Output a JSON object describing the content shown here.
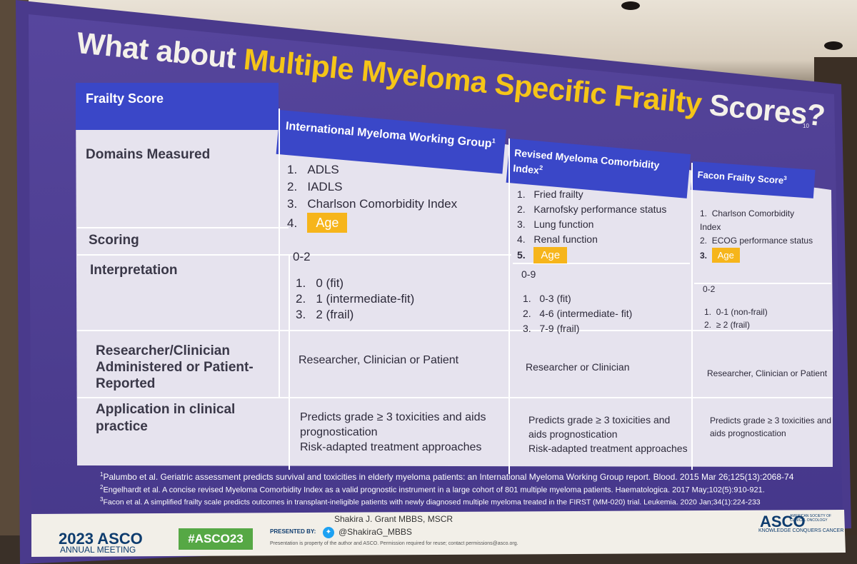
{
  "slide": {
    "title_prefix": "What about ",
    "title_highlight": "Multiple Myeloma Specific Frailty",
    "title_suffix": " Scores?",
    "slide_number": "10"
  },
  "table": {
    "corner_header": "Frailty Score",
    "columns": [
      {
        "name": "International Myeloma Working Group",
        "ref": "1"
      },
      {
        "name": "Revised Myeloma Comorbidity Index",
        "ref": "2"
      },
      {
        "name": "Facon Frailty Score",
        "ref": "3"
      }
    ],
    "row_labels": {
      "domains": "Domains Measured",
      "scoring": "Scoring",
      "interpretation": "Interpretation",
      "administered": "Researcher/Clinician Administered or Patient-Reported",
      "application": "Application in clinical practice"
    },
    "imwg": {
      "domains": [
        "ADLS",
        "IADLS",
        "Charlson Comorbidity Index",
        "Age"
      ],
      "scoring": "0-2",
      "interpretation": [
        "0 (fit)",
        "1 (intermediate-fit)",
        "2 (frail)"
      ],
      "administered": "Researcher, Clinician or Patient",
      "application": [
        "Predicts grade ≥ 3 toxicities and aids prognostication",
        "Risk-adapted treatment approaches"
      ]
    },
    "rmci": {
      "domains": [
        "Fried frailty",
        "Karnofsky performance status",
        "Lung function",
        "Renal function",
        "Age"
      ],
      "scoring": "0-9",
      "interpretation": [
        "0-3 (fit)",
        "4-6 (intermediate- fit)",
        "7-9 (frail)"
      ],
      "administered": "Researcher or Clinician",
      "application": [
        "Predicts grade ≥ 3 toxicities and aids prognostication",
        "Risk-adapted treatment approaches"
      ]
    },
    "facon": {
      "domains": [
        "Charlson Comorbidity Index",
        "ECOG performance status",
        "Age"
      ],
      "scoring": "0-2",
      "interpretation": [
        "0-1 (non-frail)",
        "≥ 2 (frail)"
      ],
      "administered": "Researcher, Clinician or Patient",
      "application": [
        "Predicts grade ≥ 3 toxicities and aids prognostication"
      ]
    }
  },
  "footnotes": [
    "Palumbo et al. Geriatric assessment predicts survival and toxicities in elderly myeloma patients: an International Myeloma Working Group report. Blood. 2015 Mar 26;125(13):2068-74",
    "Engelhardt et al. A concise revised Myeloma Comorbidity Index as a valid prognostic instrument in a large cohort of 801 multiple myeloma patients. Haematologica. 2017 May;102(5):910-921.",
    "Facon et al. A simplified frailty scale predicts outcomes in transplant-ineligible patients with newly diagnosed multiple myeloma treated in the FIRST (MM-020) trial. Leukemia. 2020 Jan;34(1):224-233"
  ],
  "banner": {
    "year": "2023 ASCO",
    "meeting": "ANNUAL MEETING",
    "hashtag": "#ASCO23",
    "presented_by": "PRESENTED BY:",
    "presenter": "Shakira J. Grant MBBS, MSCR",
    "handle": "@ShakiraG_MBBS",
    "notice": "Presentation is property of the author and ASCO. Permission required for reuse; contact permissions@asco.org.",
    "logo": "ASCO",
    "logo_sub": "AMERICAN SOCIETY OF CLINICAL ONCOLOGY",
    "tagline": "KNOWLEDGE CONQUERS CANCER"
  },
  "colors": {
    "slide_bg": "#4c3d8f",
    "header_blue": "#3a47c8",
    "highlight_yellow": "#f5c518",
    "age_orange": "#f6b51b",
    "hashtag_green": "#56a845",
    "asco_navy": "#0e3c6e"
  }
}
